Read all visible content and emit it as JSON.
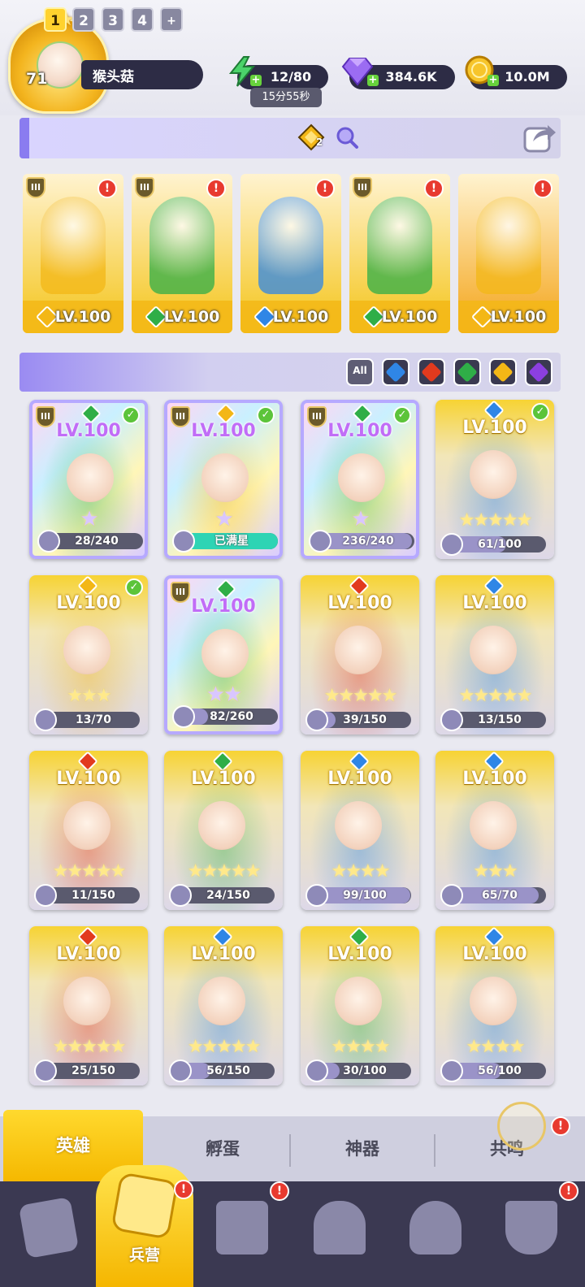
{
  "player": {
    "level": "71",
    "name": "猴头菇"
  },
  "resources": {
    "energy": {
      "value": "12/80",
      "timer": "15分55秒",
      "icon": "lightning-icon"
    },
    "gems": {
      "value": "384.6K",
      "icon": "gem-icon"
    },
    "gold": {
      "value": "10.0M",
      "icon": "coin-icon"
    }
  },
  "team_tabs": [
    {
      "label": "1",
      "active": true
    },
    {
      "label": "2",
      "active": false
    },
    {
      "label": "3",
      "active": false
    },
    {
      "label": "4",
      "active": false
    },
    {
      "label": "+",
      "active": false
    }
  ],
  "team_toolbar": {
    "ticket_count": "2"
  },
  "team": [
    {
      "level": "LV.100",
      "element": "light",
      "rank": "III",
      "alert": "!",
      "bg": "#f4c419"
    },
    {
      "level": "LV.100",
      "element": "nature",
      "rank": "III",
      "alert": "!",
      "bg": "#f4c419"
    },
    {
      "level": "LV.100",
      "element": "water",
      "rank": "",
      "alert": "!",
      "bg": "#f4c419"
    },
    {
      "level": "LV.100",
      "element": "nature",
      "rank": "III",
      "alert": "!",
      "bg": "#f4c419"
    },
    {
      "level": "LV.100",
      "element": "light",
      "rank": "",
      "alert": "!",
      "bg": "#f4a419"
    }
  ],
  "filters": [
    {
      "name": "all",
      "label": "All"
    },
    {
      "name": "water"
    },
    {
      "name": "fire"
    },
    {
      "name": "nature"
    },
    {
      "name": "light"
    },
    {
      "name": "dark"
    }
  ],
  "element_colors": {
    "water": "#2f86e6",
    "fire": "#e23a1e",
    "nature": "#2fae47",
    "light": "#f3b716",
    "dark": "#8c3fe0"
  },
  "heroes": [
    {
      "level": "LV.100",
      "element": "nature",
      "rank": "III",
      "checked": true,
      "rainbow": true,
      "stars": "★",
      "fragments": "28/240",
      "progress": 0.12
    },
    {
      "level": "LV.100",
      "element": "light",
      "rank": "III",
      "checked": true,
      "rainbow": true,
      "stars": "★",
      "fragments": "已满星",
      "progress": 1.0
    },
    {
      "level": "LV.100",
      "element": "nature",
      "rank": "III",
      "checked": true,
      "rainbow": true,
      "stars": "★",
      "fragments": "236/240",
      "progress": 0.98
    },
    {
      "level": "LV.100",
      "element": "water",
      "rank": "",
      "checked": true,
      "rainbow": false,
      "stars": "★★★★★",
      "fragments": "61/100",
      "progress": 0.61
    },
    {
      "level": "LV.100",
      "element": "light",
      "rank": "",
      "checked": true,
      "rainbow": false,
      "stars": "★★★",
      "fragments": "13/70",
      "progress": 0.19
    },
    {
      "level": "LV.100",
      "element": "nature",
      "rank": "III",
      "checked": false,
      "rainbow": true,
      "stars": "★★",
      "fragments": "82/260",
      "progress": 0.32
    },
    {
      "level": "LV.100",
      "element": "fire",
      "rank": "",
      "checked": false,
      "rainbow": false,
      "stars": "★★★★★",
      "fragments": "39/150",
      "progress": 0.26
    },
    {
      "level": "LV.100",
      "element": "water",
      "rank": "",
      "checked": false,
      "rainbow": false,
      "stars": "★★★★★",
      "fragments": "13/150",
      "progress": 0.09
    },
    {
      "level": "LV.100",
      "element": "fire",
      "rank": "",
      "checked": false,
      "rainbow": false,
      "stars": "★★★★★",
      "fragments": "11/150",
      "progress": 0.07
    },
    {
      "level": "LV.100",
      "element": "nature",
      "rank": "",
      "checked": false,
      "rainbow": false,
      "stars": "★★★★★",
      "fragments": "24/150",
      "progress": 0.16
    },
    {
      "level": "LV.100",
      "element": "water",
      "rank": "",
      "checked": false,
      "rainbow": false,
      "stars": "★★★★",
      "fragments": "99/100",
      "progress": 0.99
    },
    {
      "level": "LV.100",
      "element": "water",
      "rank": "",
      "checked": false,
      "rainbow": false,
      "stars": "★★★",
      "fragments": "65/70",
      "progress": 0.93
    },
    {
      "level": "LV.100",
      "element": "fire",
      "rank": "",
      "checked": false,
      "rainbow": false,
      "stars": "★★★★★",
      "fragments": "25/150",
      "progress": 0.17
    },
    {
      "level": "LV.100",
      "element": "water",
      "rank": "",
      "checked": false,
      "rainbow": false,
      "stars": "★★★★★",
      "fragments": "56/150",
      "progress": 0.37
    },
    {
      "level": "LV.100",
      "element": "nature",
      "rank": "",
      "checked": false,
      "rainbow": false,
      "stars": "★★★★",
      "fragments": "30/100",
      "progress": 0.3
    },
    {
      "level": "LV.100",
      "element": "water",
      "rank": "",
      "checked": false,
      "rainbow": false,
      "stars": "★★★★",
      "fragments": "56/100",
      "progress": 0.56
    }
  ],
  "sub_tabs": [
    {
      "label": "英雄",
      "active": true
    },
    {
      "label": "孵蛋",
      "active": false
    },
    {
      "label": "神器",
      "active": false
    },
    {
      "label": "共鸣",
      "active": false
    }
  ],
  "nav": {
    "active_label": "兵营",
    "items": [
      {
        "name": "cards-icon",
        "badge": ""
      },
      {
        "name": "barracks-icon",
        "badge": "!"
      },
      {
        "name": "map-icon",
        "badge": "!"
      },
      {
        "name": "castle-icon",
        "badge": ""
      },
      {
        "name": "mushroom-icon",
        "badge": ""
      },
      {
        "name": "guild-icon",
        "badge": "!"
      }
    ]
  }
}
